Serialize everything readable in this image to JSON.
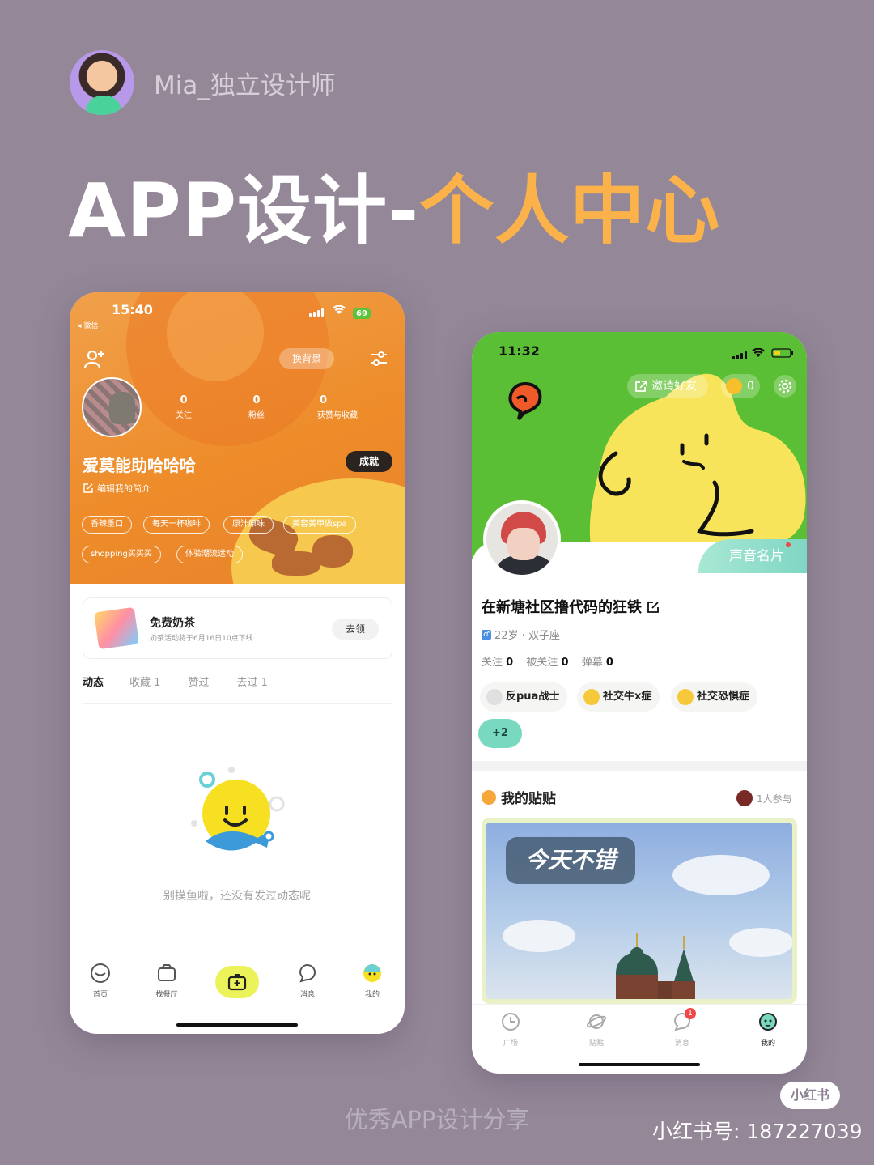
{
  "author": {
    "name": "Mia_独立设计师"
  },
  "headline": {
    "part1": "APP设计-",
    "part2": "个人中心"
  },
  "left_phone": {
    "time": "15:40",
    "back_label": "◂ 微信",
    "battery": "69",
    "change_bg": "换背景",
    "stats": [
      {
        "value": "0",
        "label": "关注"
      },
      {
        "value": "0",
        "label": "粉丝"
      },
      {
        "value": "0",
        "label": "获赞与收藏"
      }
    ],
    "nickname": "爱莫能助哈哈哈",
    "achievement": "成就",
    "bio": "编辑我的简介",
    "tags": [
      "香辣重口",
      "每天一杯咖啡",
      "原汁原味",
      "美容美甲做spa",
      "shopping买买买",
      "体验潮流运动"
    ],
    "coupon": {
      "title": "免费奶茶",
      "subtitle": "奶茶活动将于6月16日10点下线",
      "button": "去领"
    },
    "tabs": [
      "动态",
      "收藏 1",
      "赞过",
      "去过 1"
    ],
    "empty_text": "别摸鱼啦，还没有发过动态呢",
    "nav": [
      "首页",
      "找餐厅",
      "",
      "消息",
      "我的"
    ]
  },
  "right_phone": {
    "time": "11:32",
    "invite": "邀请好友",
    "coins": "0",
    "voice_card": "声音名片",
    "nickname": "在新塘社区撸代码的狂铁",
    "sex_icon": "♂",
    "age": "22岁 · 双子座",
    "follow": [
      {
        "label": "关注",
        "value": "0"
      },
      {
        "label": "被关注",
        "value": "0"
      },
      {
        "label": "弹幕",
        "value": "0"
      }
    ],
    "chips": [
      "反pua战士",
      "社交牛x症",
      "社交恐惧症"
    ],
    "more_chips": "+2",
    "posts_title": "我的贴贴",
    "joined": "1人参与",
    "photo_label": "今天不错",
    "nav": [
      "广场",
      "贴贴",
      "消息",
      "我的"
    ],
    "message_badge": "1"
  },
  "footer": {
    "caption": "优秀APP设计分享",
    "logo": "小红书",
    "id": "小红书号: 187227039"
  },
  "colors": {
    "accent_orange": "#fbb24a",
    "left_hero": "#ee8c2a",
    "right_hero": "#5bbf35",
    "background": "#948898"
  }
}
